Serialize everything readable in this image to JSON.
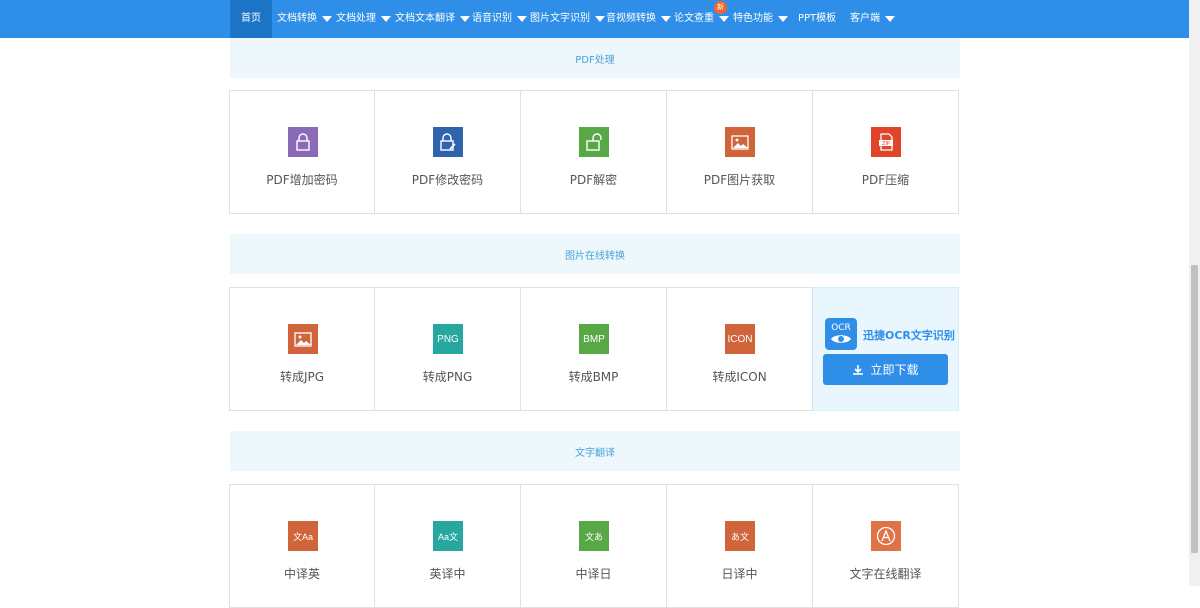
{
  "nav": {
    "items": [
      {
        "label": "首页",
        "dropdown": false
      },
      {
        "label": "文档转换",
        "dropdown": true
      },
      {
        "label": "文档处理",
        "dropdown": true
      },
      {
        "label": "文档文本翻译",
        "dropdown": true
      },
      {
        "label": "语音识别",
        "dropdown": true
      },
      {
        "label": "图片文字识别",
        "dropdown": true
      },
      {
        "label": "音视频转换",
        "dropdown": true
      },
      {
        "label": "论文查重",
        "dropdown": true,
        "badge": "新"
      },
      {
        "label": "特色功能",
        "dropdown": true
      },
      {
        "label": "PPT模板",
        "dropdown": false
      },
      {
        "label": "客户端",
        "dropdown": true
      }
    ]
  },
  "sections": {
    "pdf": {
      "title": "PDF处理",
      "cards": [
        {
          "label": "PDF增加密码",
          "icon": "lock-icon",
          "color": "#8b6bb8"
        },
        {
          "label": "PDF修改密码",
          "icon": "edit-lock-icon",
          "color": "#2f64ad"
        },
        {
          "label": "PDF解密",
          "icon": "unlock-icon",
          "color": "#58a846"
        },
        {
          "label": "PDF图片获取",
          "icon": "image-icon",
          "color": "#d0643b"
        },
        {
          "label": "PDF压缩",
          "icon": "zip-icon",
          "color": "#e0452a"
        }
      ]
    },
    "image": {
      "title": "图片在线转换",
      "cards": [
        {
          "label": "转成JPG",
          "icon": "image-icon",
          "color": "#d0643b"
        },
        {
          "label": "转成PNG",
          "icon_text": "PNG",
          "color": "#26a7a0"
        },
        {
          "label": "转成BMP",
          "icon_text": "BMP",
          "color": "#58a846"
        },
        {
          "label": "转成ICON",
          "icon_text": "ICON",
          "color": "#d0643b"
        }
      ],
      "promo": {
        "logo_text": "OCR",
        "title": "迅捷OCR文字识别",
        "button_label": "立即下载"
      }
    },
    "translate": {
      "title": "文字翻译",
      "cards": [
        {
          "label": "中译英",
          "icon_text": "文Aa",
          "color": "#d0643b"
        },
        {
          "label": "英译中",
          "icon_text": "Aa文",
          "color": "#26a7a0"
        },
        {
          "label": "中译日",
          "icon_text": "文あ",
          "color": "#58a846"
        },
        {
          "label": "日译中",
          "icon_text": "あ文",
          "color": "#d0643b"
        },
        {
          "label": "文字在线翻译",
          "icon": "translate-icon",
          "color": "#e07248"
        }
      ]
    }
  }
}
